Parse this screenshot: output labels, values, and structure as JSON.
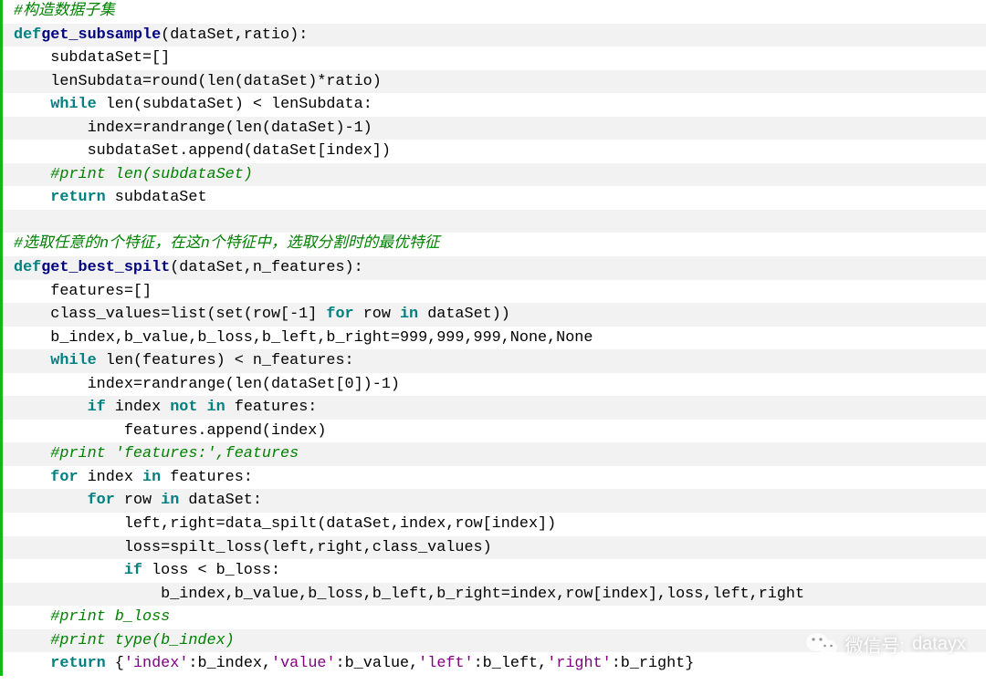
{
  "code": {
    "lines": [
      [
        [
          "cmt",
          "#构造数据子集"
        ]
      ],
      [
        [
          "kw",
          "def"
        ],
        [
          "",
          ""
        ],
        [
          "fn",
          "get_subsample"
        ],
        [
          "",
          "(dataSet,ratio):"
        ]
      ],
      [
        [
          "",
          "    subdataSet=[]"
        ]
      ],
      [
        [
          "",
          "    lenSubdata=round(len(dataSet)*ratio)"
        ]
      ],
      [
        [
          "",
          "    "
        ],
        [
          "kw",
          "while"
        ],
        [
          "",
          " len(subdataSet) < lenSubdata:"
        ]
      ],
      [
        [
          "",
          "        index=randrange(len(dataSet)-1)"
        ]
      ],
      [
        [
          "",
          "        subdataSet.append(dataSet[index])"
        ]
      ],
      [
        [
          "",
          "    "
        ],
        [
          "cmt",
          "#print len(subdataSet)"
        ]
      ],
      [
        [
          "",
          "    "
        ],
        [
          "kw",
          "return"
        ],
        [
          "",
          " subdataSet"
        ]
      ],
      [
        [
          "",
          ""
        ]
      ],
      [
        [
          "cmt",
          "#选取任意的n个特征，在这n个特征中，选取分割时的最优特征"
        ]
      ],
      [
        [
          "kw",
          "def"
        ],
        [
          "",
          ""
        ],
        [
          "fn",
          "get_best_spilt"
        ],
        [
          "",
          "(dataSet,n_features):"
        ]
      ],
      [
        [
          "",
          "    features=[]"
        ]
      ],
      [
        [
          "",
          "    class_values=list(set(row[-1] "
        ],
        [
          "kw",
          "for"
        ],
        [
          "",
          " row "
        ],
        [
          "kw",
          "in"
        ],
        [
          "",
          " dataSet))"
        ]
      ],
      [
        [
          "",
          "    b_index,b_value,b_loss,b_left,b_right=999,999,999,None,None"
        ]
      ],
      [
        [
          "",
          "    "
        ],
        [
          "kw",
          "while"
        ],
        [
          "",
          " len(features) < n_features:"
        ]
      ],
      [
        [
          "",
          "        index=randrange(len(dataSet[0])-1)"
        ]
      ],
      [
        [
          "",
          "        "
        ],
        [
          "kw",
          "if"
        ],
        [
          "",
          " index "
        ],
        [
          "kw",
          "not in"
        ],
        [
          "",
          " features:"
        ]
      ],
      [
        [
          "",
          "            features.append(index)"
        ]
      ],
      [
        [
          "",
          "    "
        ],
        [
          "cmt",
          "#print 'features:',features"
        ]
      ],
      [
        [
          "",
          "    "
        ],
        [
          "kw",
          "for"
        ],
        [
          "",
          " index "
        ],
        [
          "kw",
          "in"
        ],
        [
          "",
          " features:"
        ]
      ],
      [
        [
          "",
          "        "
        ],
        [
          "kw",
          "for"
        ],
        [
          "",
          " row "
        ],
        [
          "kw",
          "in"
        ],
        [
          "",
          " dataSet:"
        ]
      ],
      [
        [
          "",
          "            left,right=data_spilt(dataSet,index,row[index])"
        ]
      ],
      [
        [
          "",
          "            loss=spilt_loss(left,right,class_values)"
        ]
      ],
      [
        [
          "",
          "            "
        ],
        [
          "kw",
          "if"
        ],
        [
          "",
          " loss < b_loss:"
        ]
      ],
      [
        [
          "",
          "                b_index,b_value,b_loss,b_left,b_right=index,row[index],loss,left,right"
        ]
      ],
      [
        [
          "",
          "    "
        ],
        [
          "cmt",
          "#print b_loss"
        ]
      ],
      [
        [
          "",
          "    "
        ],
        [
          "cmt",
          "#print type(b_index)"
        ]
      ],
      [
        [
          "",
          "    "
        ],
        [
          "kw",
          "return"
        ],
        [
          "",
          " {"
        ],
        [
          "str",
          "'index'"
        ],
        [
          "",
          ":b_index,"
        ],
        [
          "str",
          "'value'"
        ],
        [
          "",
          ":b_value,"
        ],
        [
          "str",
          "'left'"
        ],
        [
          "",
          ":b_left,"
        ],
        [
          "str",
          "'right'"
        ],
        [
          "",
          ":b_right}"
        ]
      ]
    ]
  },
  "watermark": {
    "label_prefix": "微信号:",
    "account": "datayx",
    "icon": "wechat-icon"
  }
}
